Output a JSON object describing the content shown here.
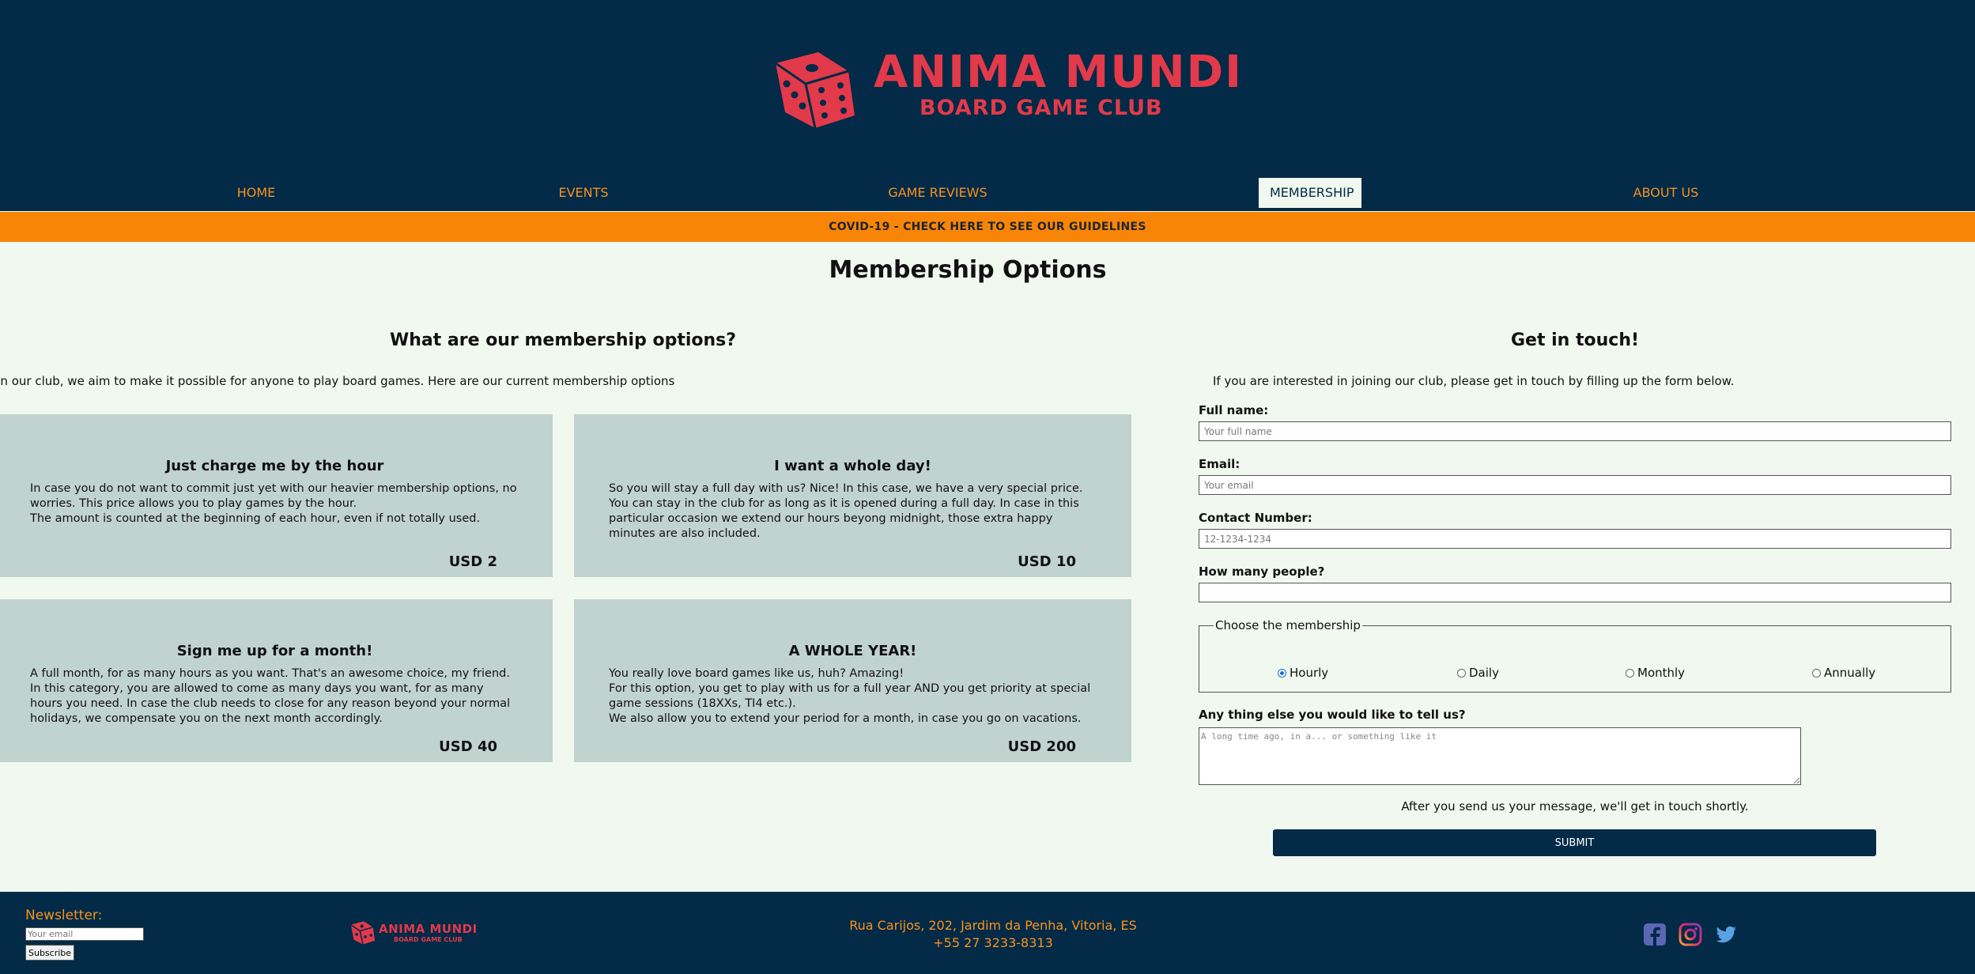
{
  "brand": {
    "name": "ANIMA MUNDI",
    "tagline": "BOARD GAME CLUB"
  },
  "nav": {
    "items": [
      {
        "label": "HOME"
      },
      {
        "label": "EVENTS"
      },
      {
        "label": "GAME REVIEWS"
      },
      {
        "label": "MEMBERSHIP",
        "active": true
      },
      {
        "label": "ABOUT US"
      }
    ]
  },
  "banner": {
    "text": "COVID-19 - CHECK HERE TO SEE OUR GUIDELINES"
  },
  "page": {
    "title": "Membership Options"
  },
  "options": {
    "heading": "What are our membership options?",
    "intro": "In our club, we aim to make it possible for anyone to play board games. Here are our current membership options",
    "cards": [
      {
        "title": "Just charge me by the hour",
        "lines": [
          "In case you do not want to commit just yet with our heavier membership options, no worries. This price allows you to play games by the hour.",
          "The amount is counted at the beginning of each hour, even if not totally used."
        ],
        "price": "USD 2"
      },
      {
        "title": "I want a whole day!",
        "lines": [
          "So you will stay a full day with us? Nice! In this case, we have a very special price.",
          "You can stay in the club for as long as it is opened during a full day. In case in this particular occasion we extend our hours beyong midnight, those extra happy minutes are also included."
        ],
        "price": "USD 10"
      },
      {
        "title": "Sign me up for a month!",
        "lines": [
          "A full month, for as many hours as you want. That's an awesome choice, my friend.",
          "In this category, you are allowed to come as many days you want, for as many hours you need. In case the club needs to close for any reason beyond your normal holidays, we compensate you on the next month accordingly."
        ],
        "price": "USD 40"
      },
      {
        "title": "A WHOLE YEAR!",
        "lines": [
          "You really love board games like us, huh? Amazing!",
          "For this option, you get to play with us for a full year AND you get priority at special game sessions (18XXs, TI4 etc.).",
          "We also allow you to extend your period for a month, in case you go on vacations."
        ],
        "price": "USD 200"
      }
    ]
  },
  "contact": {
    "heading": "Get in touch!",
    "intro": "If you are interested in joining our club, please get in touch by filling up the form below.",
    "full_name": {
      "label": "Full name:",
      "placeholder": "Your full name"
    },
    "email": {
      "label": "Email:",
      "placeholder": "Your email"
    },
    "phone": {
      "label": "Contact Number:",
      "placeholder": "12-1234-1234"
    },
    "people": {
      "label": "How many people?",
      "placeholder": ""
    },
    "membership": {
      "legend": "Choose the membership",
      "options": [
        {
          "label": "Hourly",
          "checked": true
        },
        {
          "label": "Daily",
          "checked": false
        },
        {
          "label": "Monthly",
          "checked": false
        },
        {
          "label": "Annually",
          "checked": false
        }
      ]
    },
    "message": {
      "label": "Any thing else you would like to tell us?",
      "placeholder": "A long time ago, in a... or something like it"
    },
    "note": "After you send us your message, we'll get in touch shortly.",
    "submit": "SUBMIT"
  },
  "footer": {
    "newsletter_label": "Newsletter:",
    "newsletter_placeholder": "Your email",
    "subscribe": "Subscribe",
    "address": "Rua Carijos, 202, Jardim da Penha, Vitoria, ES",
    "phone": "+55 27 3233-8313",
    "social": [
      {
        "icon": "facebook-icon"
      },
      {
        "icon": "instagram-icon"
      },
      {
        "icon": "twitter-icon"
      }
    ]
  },
  "colors": {
    "navy": "#032a47",
    "orange": "#f7931e",
    "brand_red": "#e23a4a",
    "card": "#c1d3cf",
    "background": "#f0f8ef"
  }
}
